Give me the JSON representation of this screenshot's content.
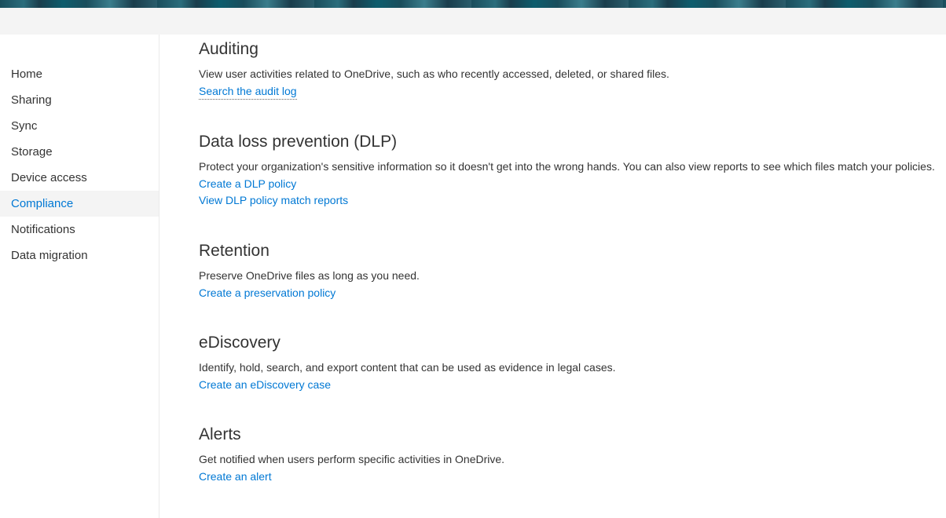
{
  "sidebar": {
    "items": [
      {
        "label": "Home",
        "active": false
      },
      {
        "label": "Sharing",
        "active": false
      },
      {
        "label": "Sync",
        "active": false
      },
      {
        "label": "Storage",
        "active": false
      },
      {
        "label": "Device access",
        "active": false
      },
      {
        "label": "Compliance",
        "active": true
      },
      {
        "label": "Notifications",
        "active": false
      },
      {
        "label": "Data migration",
        "active": false
      }
    ]
  },
  "sections": {
    "auditing": {
      "heading": "Auditing",
      "desc": "View user activities related to OneDrive, such as who recently accessed, deleted, or shared files.",
      "link1": "Search the audit log"
    },
    "dlp": {
      "heading": "Data loss prevention (DLP)",
      "desc": "Protect your organization's sensitive information so it doesn't get into the wrong hands. You can also view reports to see which files match your policies.",
      "link1": "Create a DLP policy",
      "link2": "View DLP policy match reports"
    },
    "retention": {
      "heading": "Retention",
      "desc": "Preserve OneDrive files as long as you need.",
      "link1": "Create a preservation policy"
    },
    "ediscovery": {
      "heading": "eDiscovery",
      "desc": "Identify, hold, search, and export content that can be used as evidence in legal cases.",
      "link1": "Create an eDiscovery case"
    },
    "alerts": {
      "heading": "Alerts",
      "desc": "Get notified when users perform specific activities in OneDrive.",
      "link1": "Create an alert"
    }
  }
}
